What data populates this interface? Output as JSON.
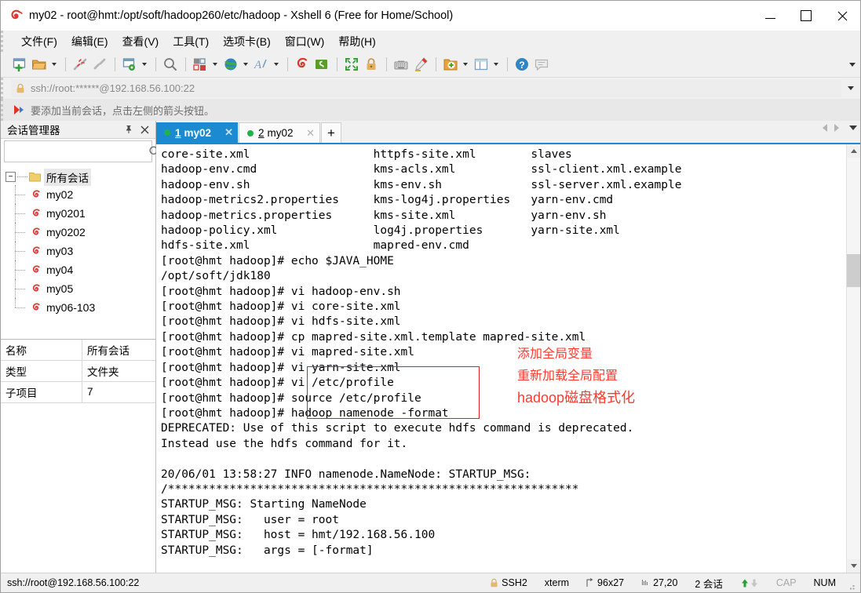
{
  "window": {
    "title": "my02 - root@hmt:/opt/soft/hadoop260/etc/hadoop - Xshell 6 (Free for Home/School)",
    "app_icon": "xshell-snail-icon",
    "minimize_label": "",
    "maximize_label": "",
    "close_label": "✕"
  },
  "menubar": {
    "items": [
      {
        "label": "文件(F)",
        "name": "menu-file"
      },
      {
        "label": "编辑(E)",
        "name": "menu-edit"
      },
      {
        "label": "查看(V)",
        "name": "menu-view"
      },
      {
        "label": "工具(T)",
        "name": "menu-tools"
      },
      {
        "label": "选项卡(B)",
        "name": "menu-tabs"
      },
      {
        "label": "窗口(W)",
        "name": "menu-window"
      },
      {
        "label": "帮助(H)",
        "name": "menu-help"
      }
    ]
  },
  "toolbar": {
    "buttons": [
      {
        "icon": "new-session-icon"
      },
      {
        "icon": "open-folder-icon",
        "dropdown": true
      },
      {
        "icon": "disconnect-icon"
      },
      {
        "icon": "reconnect-icon"
      },
      {
        "icon": "session-properties-icon",
        "dropdown": true
      },
      {
        "icon": "find-icon"
      },
      {
        "icon": "file-transfer-icon",
        "dropdown": true
      },
      {
        "icon": "globe-icon",
        "dropdown": true
      },
      {
        "icon": "font-icon",
        "dropdown": true
      },
      {
        "icon": "xshell-icon"
      },
      {
        "icon": "xftp-icon"
      },
      {
        "icon": "fullscreen-icon"
      },
      {
        "icon": "lock-icon"
      },
      {
        "icon": "keyboard-icon"
      },
      {
        "icon": "highlight-pen-icon"
      },
      {
        "icon": "add-folder-icon",
        "dropdown": true
      },
      {
        "icon": "layout-panes-icon",
        "dropdown": true
      },
      {
        "icon": "help-icon"
      },
      {
        "icon": "comment-icon"
      }
    ],
    "overflow_label": ""
  },
  "address_bar": {
    "lock_icon": "lock-icon",
    "value": "ssh://root:******@192.168.56.100:22",
    "placeholder": "ssh://root:******@192.168.56.100:22",
    "dropdown_label": ""
  },
  "notification": {
    "icon": "red-arrow-flag-icon",
    "text": "要添加当前会话，点击左侧的箭头按钮。"
  },
  "sidebar": {
    "title": "会话管理器",
    "pin_label": "📌",
    "close_label": "✕",
    "search": {
      "value": "",
      "placeholder": ""
    },
    "tree": {
      "root_label": "所有会话",
      "toggle": "−",
      "children": [
        {
          "label": "my02",
          "icon": "session-icon"
        },
        {
          "label": "my0201",
          "icon": "session-icon"
        },
        {
          "label": "my0202",
          "icon": "session-icon"
        },
        {
          "label": "my03",
          "icon": "session-icon"
        },
        {
          "label": "my04",
          "icon": "session-icon"
        },
        {
          "label": "my05",
          "icon": "session-icon"
        },
        {
          "label": "my06-103",
          "icon": "session-icon"
        }
      ]
    },
    "properties": [
      {
        "key": "名称",
        "value": "所有会话"
      },
      {
        "key": "类型",
        "value": "文件夹"
      },
      {
        "key": "子项目",
        "value": "7"
      }
    ]
  },
  "tabs": {
    "items": [
      {
        "num": "1",
        "label": "my02",
        "active": true,
        "close": "✕",
        "status": "connected"
      },
      {
        "num": "2",
        "label": "my02",
        "active": false,
        "close": "✕",
        "status": "connected"
      }
    ],
    "add_label": "+",
    "nav_prev": "",
    "nav_next": "",
    "nav_list": ""
  },
  "terminal": {
    "lines": [
      "core-site.xml                  httpfs-site.xml        slaves",
      "hadoop-env.cmd                 kms-acls.xml           ssl-client.xml.example",
      "hadoop-env.sh                  kms-env.sh             ssl-server.xml.example",
      "hadoop-metrics2.properties     kms-log4j.properties   yarn-env.cmd",
      "hadoop-metrics.properties      kms-site.xml           yarn-env.sh",
      "hadoop-policy.xml              log4j.properties       yarn-site.xml",
      "hdfs-site.xml                  mapred-env.cmd",
      "[root@hmt hadoop]# echo $JAVA_HOME",
      "/opt/soft/jdk180",
      "[root@hmt hadoop]# vi hadoop-env.sh",
      "[root@hmt hadoop]# vi core-site.xml",
      "[root@hmt hadoop]# vi hdfs-site.xml",
      "[root@hmt hadoop]# cp mapred-site.xml.template mapred-site.xml",
      "[root@hmt hadoop]# vi mapred-site.xml",
      "[root@hmt hadoop]# vi yarn-site.xml",
      "[root@hmt hadoop]# vi /etc/profile",
      "[root@hmt hadoop]# source /etc/profile",
      "[root@hmt hadoop]# hadoop namenode -format",
      "DEPRECATED: Use of this script to execute hdfs command is deprecated.",
      "Instead use the hdfs command for it.",
      "",
      "20/06/01 13:58:27 INFO namenode.NameNode: STARTUP_MSG:",
      "/************************************************************",
      "STARTUP_MSG: Starting NameNode",
      "STARTUP_MSG:   user = root",
      "STARTUP_MSG:   host = hmt/192.168.56.100",
      "STARTUP_MSG:   args = [-format]"
    ],
    "annotations": [
      {
        "text": "添加全局变量",
        "color": "#ff3b30"
      },
      {
        "text": "重新加载全局配置",
        "color": "#ff3b30"
      },
      {
        "text": "hadoop磁盘格式化",
        "color": "#ff3b30"
      }
    ],
    "highlight_box_color": "#e02020"
  },
  "statusbar": {
    "left": "ssh://root@192.168.56.100:22",
    "protocol": "SSH2",
    "terminal_type": "xterm",
    "size": "96x27",
    "cursor": "27,20",
    "sessions": "2 会话",
    "cap": "CAP",
    "num": "NUM",
    "up_arrow": "▲",
    "down_arrow": "▼"
  },
  "colors": {
    "accent": "#1b8ad1",
    "annotation_red": "#ff3b30",
    "connected_green": "#22b14c",
    "chrome_gray": "#f0f0f0"
  }
}
